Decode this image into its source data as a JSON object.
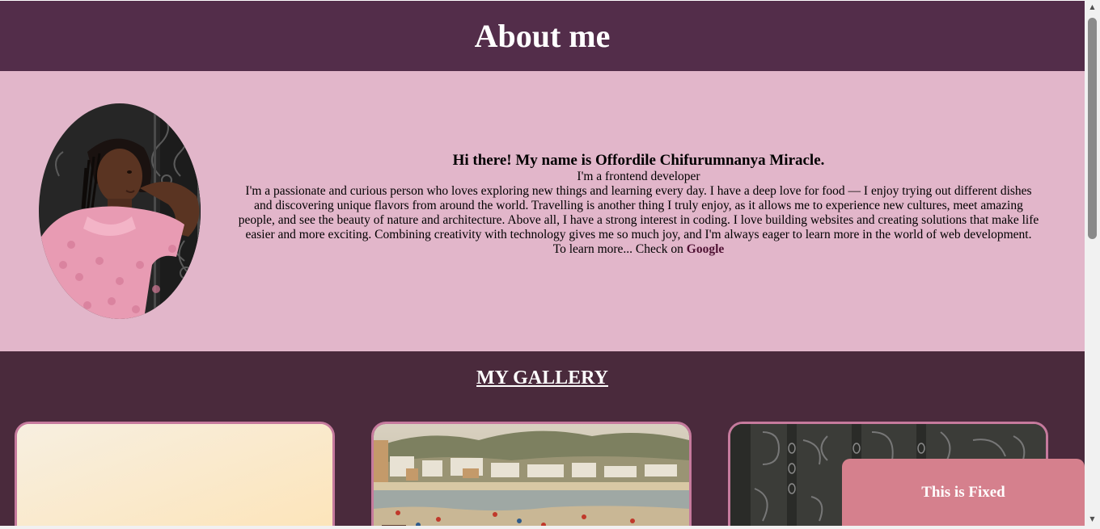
{
  "header": {
    "title": "About me"
  },
  "about": {
    "avatar": "profile-photo",
    "greeting": "Hi there! My name is Offordile Chifurumnanya Miracle.",
    "role": "I'm a frontend developer",
    "bio": "I'm a passionate and curious person who loves exploring new things and learning every day. I have a deep love for food — I enjoy trying out different dishes and discovering unique flavors from around the world. Travelling is another thing I truly enjoy, as it allows me to experience new cultures, meet amazing people, and see the beauty of nature and architecture. Above all, I have a strong interest in coding. I love building websites and creating solutions that make life easier and more exciting. Combining creativity with technology gives me so much joy, and I'm always eager to learn more in the world of web development.",
    "learn_more_prefix": "To learn more... Check on ",
    "learn_more_link": "Google"
  },
  "gallery": {
    "title": "MY GALLERY",
    "items": [
      {
        "name": "gallery-photo-cream"
      },
      {
        "name": "gallery-photo-beach"
      },
      {
        "name": "gallery-photo-gate"
      }
    ]
  },
  "fixed": {
    "label": "This is Fixed"
  },
  "colors": {
    "header_bg": "#532d4a",
    "about_bg": "#e2b6ca",
    "gallery_bg": "#4a2a3c",
    "card_border": "#c67a9d",
    "fixed_bg": "#d5808d",
    "link": "#4f1133"
  }
}
